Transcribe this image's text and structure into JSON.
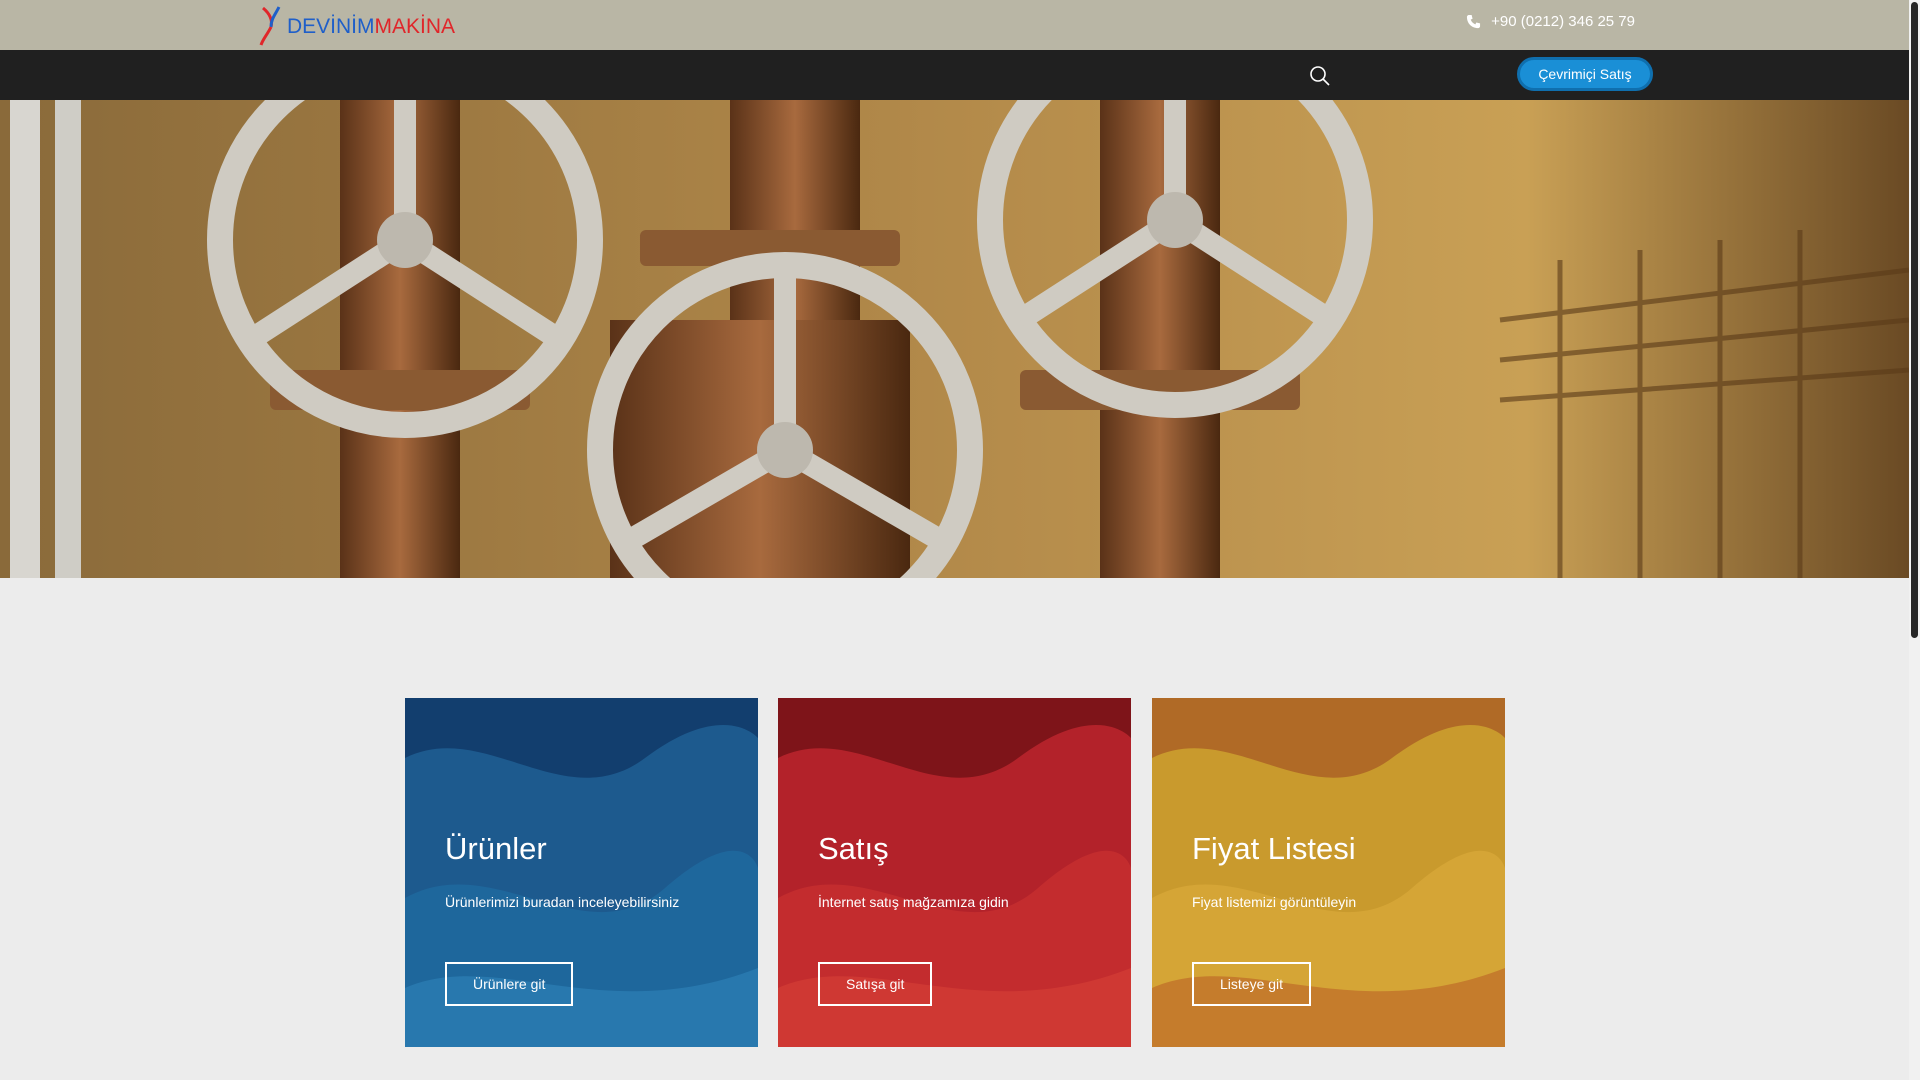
{
  "header": {
    "logo": {
      "part1": "DEVİNİM",
      "part2": "MAKİNA"
    },
    "phone": "+90 (0212) 346 25 79",
    "cta_label": "Çevrimiçi Satış"
  },
  "cards": [
    {
      "title": "Ürünler",
      "text": "Ürünlerimizi buradan inceleyebilirsiniz",
      "button": "Ürünlere git"
    },
    {
      "title": "Satış",
      "text": "İnternet satış mağzamıza gidin",
      "button": "Satışa git"
    },
    {
      "title": "Fiyat Listesi",
      "text": "Fiyat listemizi görüntüleyin",
      "button": "Listeye git"
    }
  ],
  "colors": {
    "topbar": "#b9b6a5",
    "navbar": "#202020",
    "cta": "#1a8fd6",
    "card_blue": "#1d5a8e",
    "card_red": "#b3222a",
    "card_gold": "#c99a2d"
  }
}
